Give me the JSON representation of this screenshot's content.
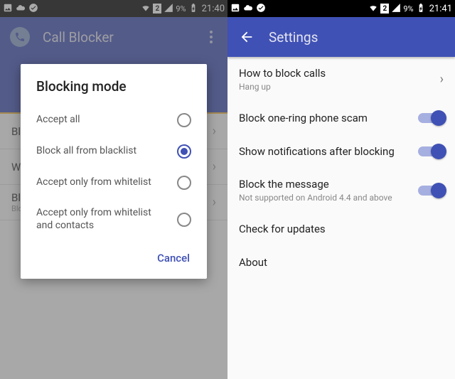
{
  "left": {
    "status": {
      "battery": "9%",
      "time": "21:40",
      "sim": "2"
    },
    "appbar": {
      "title": "Call Blocker"
    },
    "bg_rows": [
      {
        "title": "Blacklist"
      },
      {
        "title": "Whitelist"
      },
      {
        "title": "Blocking mode",
        "sub": "Block all from blacklist"
      }
    ],
    "dialog": {
      "title": "Blocking mode",
      "options": [
        {
          "label": "Accept all",
          "checked": false
        },
        {
          "label": "Block all from blacklist",
          "checked": true
        },
        {
          "label": "Accept only from whitelist",
          "checked": false
        },
        {
          "label": "Accept only from whitelist and contacts",
          "checked": false
        }
      ],
      "cancel": "Cancel"
    }
  },
  "right": {
    "status": {
      "battery": "9%",
      "time": "21:41",
      "sim": "2"
    },
    "appbar": {
      "title": "Settings"
    },
    "rows": [
      {
        "title": "How to block calls",
        "sub": "Hang up",
        "type": "arrow"
      },
      {
        "title": "Block one-ring phone scam",
        "type": "switch"
      },
      {
        "title": "Show notifications after blocking",
        "type": "switch"
      },
      {
        "title": "Block the message",
        "sub": "Not supported on Android 4.4 and above",
        "type": "switch"
      },
      {
        "title": "Check for updates",
        "type": "none"
      },
      {
        "title": "About",
        "type": "none"
      }
    ]
  }
}
